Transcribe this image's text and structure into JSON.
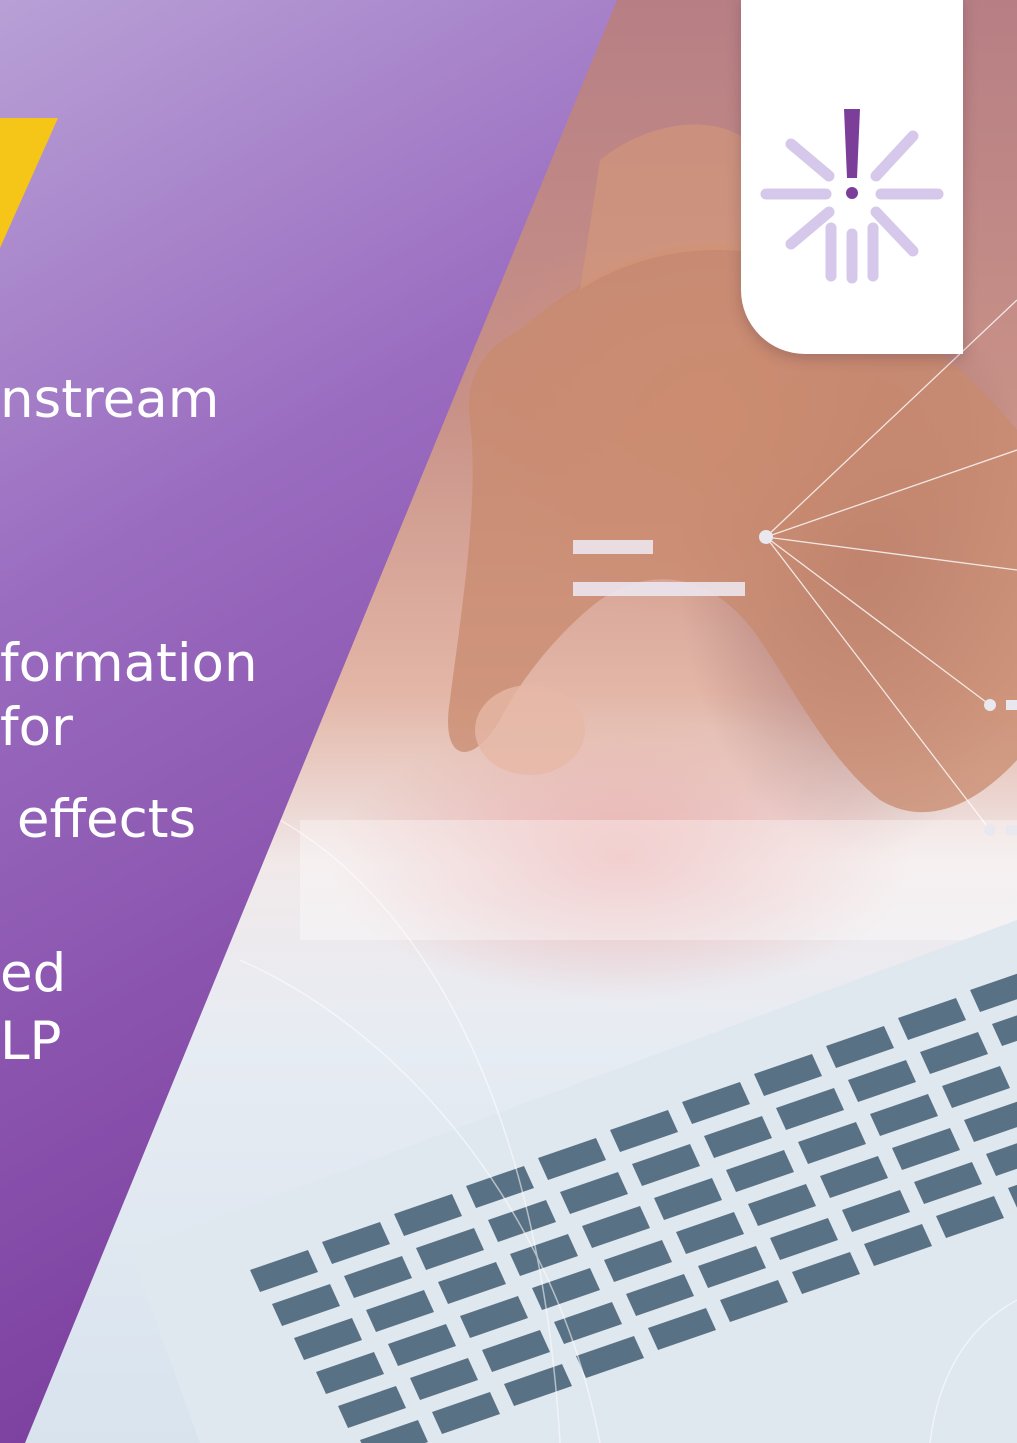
{
  "colors": {
    "panel_purple_top": "#a98dcc",
    "panel_purple_bottom": "#7a3d9c",
    "accent_yellow": "#f5c518",
    "logo_purple": "#7b3f99",
    "logo_lavender": "#d6c8ea",
    "text": "#ffffff"
  },
  "icons": {
    "logo": "burst-exclamation-icon",
    "menu_lines": "double-line-icon"
  },
  "text_lines": {
    "line1": "nstream",
    "line2": "formation",
    "line3": "for",
    "line4": " effects",
    "line5": "ed",
    "line6": "LP"
  }
}
